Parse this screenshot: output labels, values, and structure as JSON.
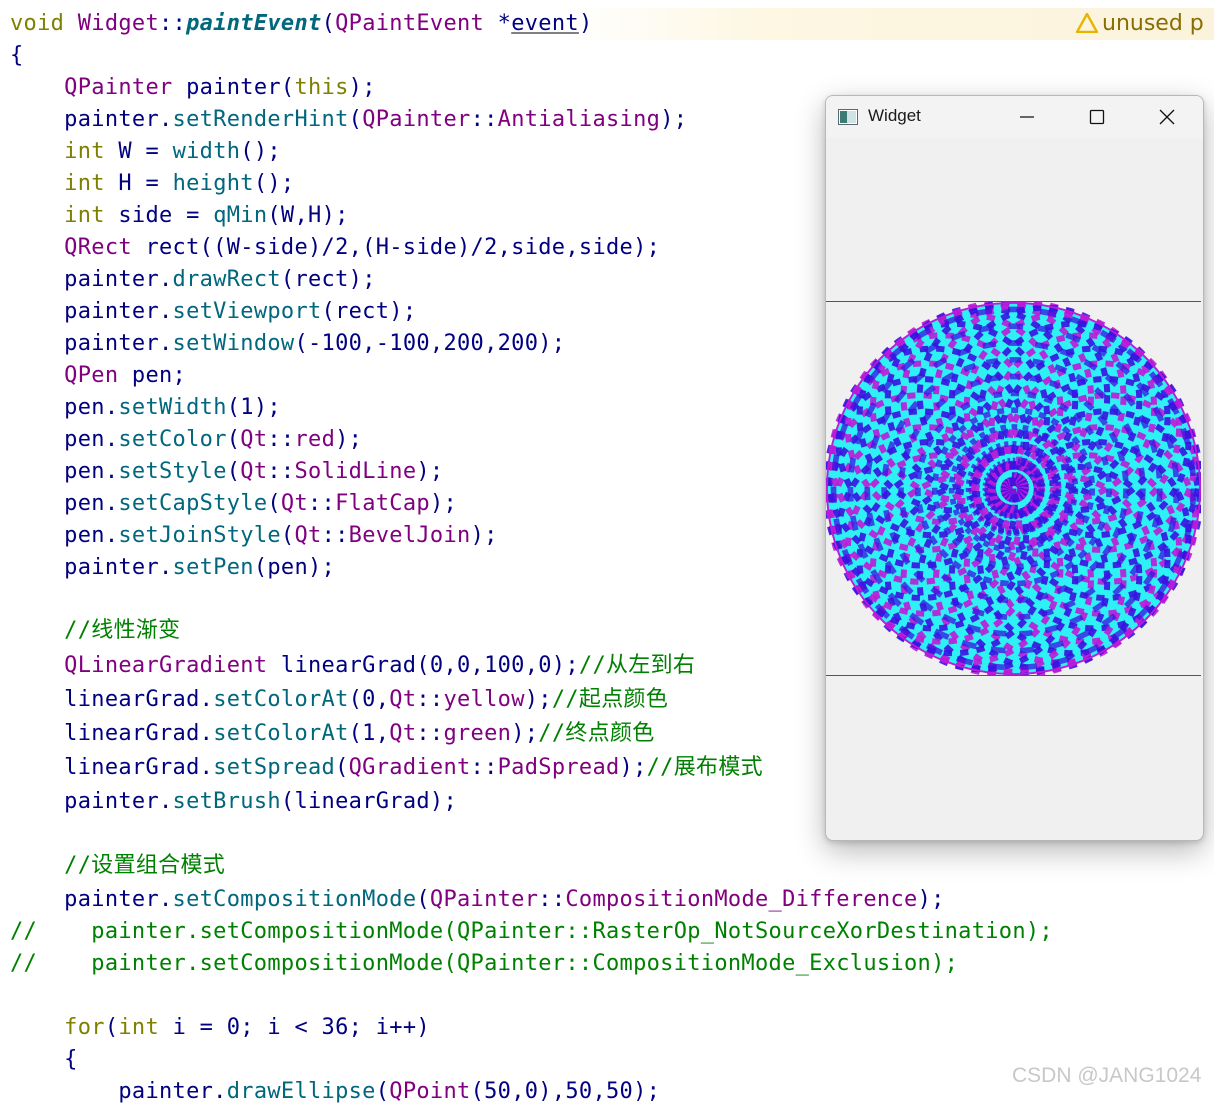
{
  "editor": {
    "warning_label": "unused p",
    "lines": [
      [
        [
          "kw",
          "void "
        ],
        [
          "typ",
          "Widget"
        ],
        [
          "",
          "::"
        ],
        [
          "it",
          "paintEvent"
        ],
        [
          "",
          "("
        ],
        [
          "typ",
          "QPaintEvent "
        ],
        [
          "",
          "*"
        ],
        [
          "ul",
          "event"
        ],
        [
          "",
          ")"
        ]
      ],
      [
        [
          "",
          "{"
        ]
      ],
      [
        [
          "typ",
          "    QPainter "
        ],
        [
          "",
          "painter("
        ],
        [
          "kw",
          "this"
        ],
        [
          "",
          ");"
        ]
      ],
      [
        [
          "",
          "    painter."
        ],
        [
          "fn",
          "setRenderHint"
        ],
        [
          "",
          "("
        ],
        [
          "typ",
          "QPainter"
        ],
        [
          "",
          "::"
        ],
        [
          "enm",
          "Antialiasing"
        ],
        [
          "",
          ");"
        ]
      ],
      [
        [
          "kw",
          "    int "
        ],
        [
          "",
          "W = "
        ],
        [
          "fn",
          "width"
        ],
        [
          "",
          "();"
        ]
      ],
      [
        [
          "kw",
          "    int "
        ],
        [
          "",
          "H = "
        ],
        [
          "fn",
          "height"
        ],
        [
          "",
          "();"
        ]
      ],
      [
        [
          "kw",
          "    int "
        ],
        [
          "",
          "side = "
        ],
        [
          "fn",
          "qMin"
        ],
        [
          "",
          "(W,H);"
        ]
      ],
      [
        [
          "typ",
          "    QRect "
        ],
        [
          "",
          "rect((W-side)/2,(H-side)/2,side,side);"
        ]
      ],
      [
        [
          "",
          "    painter."
        ],
        [
          "fn",
          "drawRect"
        ],
        [
          "",
          "(rect);"
        ]
      ],
      [
        [
          "",
          "    painter."
        ],
        [
          "fn",
          "setViewport"
        ],
        [
          "",
          "(rect);"
        ]
      ],
      [
        [
          "",
          "    painter."
        ],
        [
          "fn",
          "setWindow"
        ],
        [
          "",
          "(-100,-100,200,200);"
        ]
      ],
      [
        [
          "typ",
          "    QPen "
        ],
        [
          "",
          "pen;"
        ]
      ],
      [
        [
          "",
          "    pen."
        ],
        [
          "fn",
          "setWidth"
        ],
        [
          "",
          "(1);"
        ]
      ],
      [
        [
          "",
          "    pen."
        ],
        [
          "fn",
          "setColor"
        ],
        [
          "",
          "("
        ],
        [
          "typ",
          "Qt"
        ],
        [
          "",
          "::"
        ],
        [
          "enm",
          "red"
        ],
        [
          "",
          ");"
        ]
      ],
      [
        [
          "",
          "    pen."
        ],
        [
          "fn",
          "setStyle"
        ],
        [
          "",
          "("
        ],
        [
          "typ",
          "Qt"
        ],
        [
          "",
          "::"
        ],
        [
          "enm",
          "SolidLine"
        ],
        [
          "",
          ");"
        ]
      ],
      [
        [
          "",
          "    pen."
        ],
        [
          "fn",
          "setCapStyle"
        ],
        [
          "",
          "("
        ],
        [
          "typ",
          "Qt"
        ],
        [
          "",
          "::"
        ],
        [
          "enm",
          "FlatCap"
        ],
        [
          "",
          ");"
        ]
      ],
      [
        [
          "",
          "    pen."
        ],
        [
          "fn",
          "setJoinStyle"
        ],
        [
          "",
          "("
        ],
        [
          "typ",
          "Qt"
        ],
        [
          "",
          "::"
        ],
        [
          "enm",
          "BevelJoin"
        ],
        [
          "",
          ");"
        ]
      ],
      [
        [
          "",
          "    painter."
        ],
        [
          "fn",
          "setPen"
        ],
        [
          "",
          "(pen);"
        ]
      ],
      [
        [
          "",
          ""
        ]
      ],
      [
        [
          "cmt",
          "    //线性渐变"
        ]
      ],
      [
        [
          "typ",
          "    QLinearGradient "
        ],
        [
          "",
          "linearGrad(0,0,100,0);"
        ],
        [
          "cmt",
          "//从左到右"
        ]
      ],
      [
        [
          "",
          "    linearGrad."
        ],
        [
          "fn",
          "setColorAt"
        ],
        [
          "",
          "(0,"
        ],
        [
          "typ",
          "Qt"
        ],
        [
          "",
          "::"
        ],
        [
          "enm",
          "yellow"
        ],
        [
          "",
          ");"
        ],
        [
          "cmt",
          "//起点颜色"
        ]
      ],
      [
        [
          "",
          "    linearGrad."
        ],
        [
          "fn",
          "setColorAt"
        ],
        [
          "",
          "(1,"
        ],
        [
          "typ",
          "Qt"
        ],
        [
          "",
          "::"
        ],
        [
          "enm",
          "green"
        ],
        [
          "",
          ");"
        ],
        [
          "cmt",
          "//终点颜色"
        ]
      ],
      [
        [
          "",
          "    linearGrad."
        ],
        [
          "fn",
          "setSpread"
        ],
        [
          "",
          "("
        ],
        [
          "typ",
          "QGradient"
        ],
        [
          "",
          "::"
        ],
        [
          "enm",
          "PadSpread"
        ],
        [
          "",
          ");"
        ],
        [
          "cmt",
          "//展布模式"
        ]
      ],
      [
        [
          "",
          "    painter."
        ],
        [
          "fn",
          "setBrush"
        ],
        [
          "",
          "(linearGrad);"
        ]
      ],
      [
        [
          "",
          ""
        ]
      ],
      [
        [
          "cmt",
          "    //设置组合模式"
        ]
      ],
      [
        [
          "",
          "    painter."
        ],
        [
          "fn",
          "setCompositionMode"
        ],
        [
          "",
          "("
        ],
        [
          "typ",
          "QPainter"
        ],
        [
          "",
          "::"
        ],
        [
          "enm",
          "CompositionMode_Difference"
        ],
        [
          "",
          ");"
        ]
      ],
      [
        [
          "cmt",
          "//    painter.setCompositionMode(QPainter::RasterOp_NotSourceXorDestination);"
        ]
      ],
      [
        [
          "cmt",
          "//    painter.setCompositionMode(QPainter::CompositionMode_Exclusion);"
        ]
      ],
      [
        [
          "",
          ""
        ]
      ],
      [
        [
          "kw",
          "    for"
        ],
        [
          "",
          "("
        ],
        [
          "kw",
          "int "
        ],
        [
          "",
          "i = 0; i < 36; i++)"
        ]
      ],
      [
        [
          "",
          "    {"
        ]
      ],
      [
        [
          "",
          "        painter."
        ],
        [
          "fn",
          "drawEllipse"
        ],
        [
          "",
          "("
        ],
        [
          "typ",
          "QPoint"
        ],
        [
          "",
          "(50,0),50,50);"
        ]
      ]
    ]
  },
  "window": {
    "title": "Widget"
  },
  "watermark": "CSDN @JANG1024",
  "colors": {
    "fill_a": "#2ef1f5",
    "fill_b": "#3a12e0",
    "fill_edge": "#c01ad8"
  }
}
